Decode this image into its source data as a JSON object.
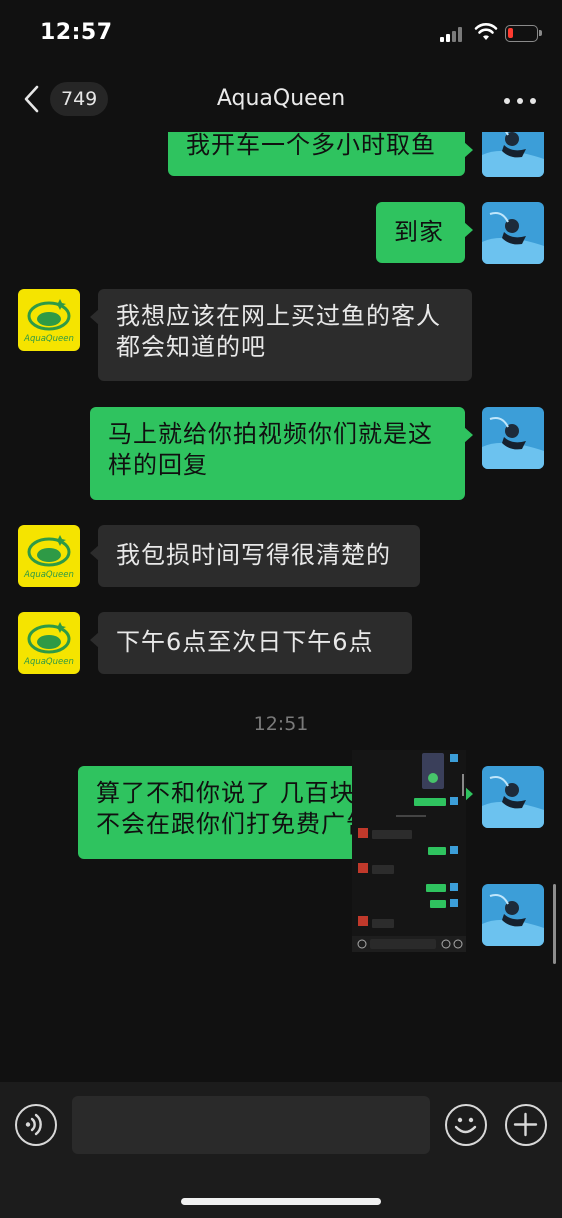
{
  "status_bar": {
    "time": "12:57"
  },
  "nav": {
    "unread_count": "749",
    "title": "AquaQueen"
  },
  "contact": {
    "name": "AquaQueen",
    "logo_text": "AquaQueen"
  },
  "messages": [
    {
      "side": "out",
      "text": "我开车一个多小时取鱼"
    },
    {
      "side": "out",
      "text": "到家"
    },
    {
      "side": "in",
      "text": "我想应该在网上买过鱼的客人都会知道的吧"
    },
    {
      "side": "out",
      "text": "马上就给你拍视频你们就是这样的回复"
    },
    {
      "side": "in",
      "text": "我包损时间写得很清楚的"
    },
    {
      "side": "in",
      "text": "下午6点至次日下午6点"
    },
    {
      "side": "out",
      "text": "算了不和你说了 几百块钱 我也不会在跟你们打免费广告了"
    },
    {
      "side": "out",
      "type": "image",
      "text": ""
    }
  ],
  "timestamp": "12:51",
  "colors": {
    "outgoing_bubble": "#2fc35f",
    "incoming_bubble": "#2c2c2c",
    "background": "#111111",
    "logo_yellow": "#f5e400",
    "logo_green": "#2e9a46"
  },
  "icons": [
    "back-icon",
    "more-icon",
    "voice-icon",
    "emoji-icon",
    "plus-icon"
  ]
}
